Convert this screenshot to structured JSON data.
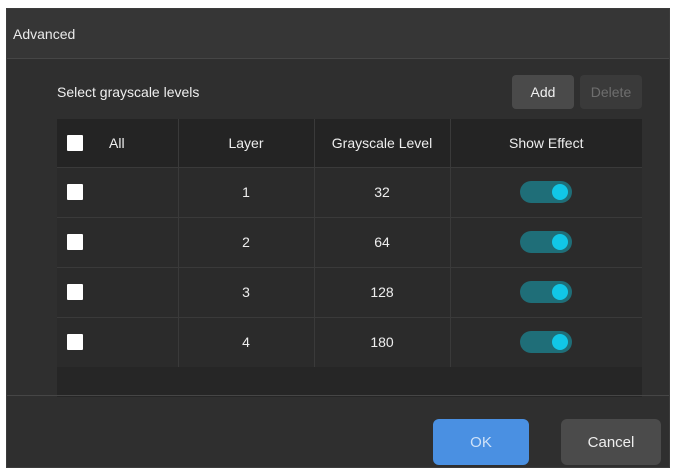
{
  "dialog": {
    "title": "Advanced",
    "section_label": "Select grayscale levels",
    "add_label": "Add",
    "delete_label": "Delete",
    "ok_label": "OK",
    "cancel_label": "Cancel"
  },
  "table": {
    "headers": {
      "all": "All",
      "layer": "Layer",
      "grayscale": "Grayscale Level",
      "show_effect": "Show Effect"
    },
    "rows": [
      {
        "layer": "1",
        "grayscale": "32",
        "checked": false,
        "show_effect": true
      },
      {
        "layer": "2",
        "grayscale": "64",
        "checked": false,
        "show_effect": true
      },
      {
        "layer": "3",
        "grayscale": "128",
        "checked": false,
        "show_effect": true
      },
      {
        "layer": "4",
        "grayscale": "180",
        "checked": false,
        "show_effect": true
      }
    ]
  },
  "colors": {
    "dialog_bg": "#2f2f2f",
    "toggle_track": "#1f6e78",
    "toggle_knob": "#11c6e6",
    "ok_button": "#4a90e2"
  },
  "icons": [
    "checkbox-icon",
    "toggle-switch"
  ]
}
